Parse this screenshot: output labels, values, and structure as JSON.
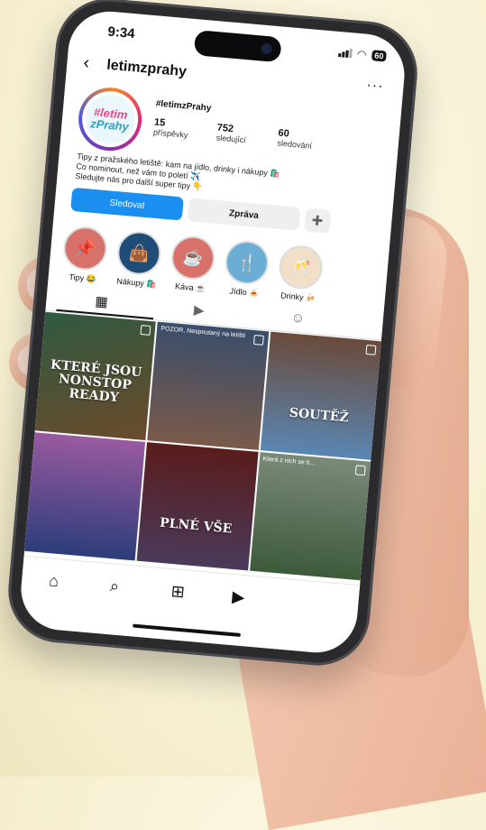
{
  "status_bar": {
    "time": "9:34",
    "battery": "60"
  },
  "header": {
    "back_icon": "chevron-left-icon",
    "username": "letimzprahy",
    "more_label": "···"
  },
  "profile": {
    "avatar_line1": "#letim",
    "avatar_line2": "zPrahy",
    "name": "#letimzPrahy",
    "stats": [
      {
        "value": "15",
        "label": "příspěvky"
      },
      {
        "value": "752",
        "label": "sledující"
      },
      {
        "value": "60",
        "label": "sledování"
      }
    ],
    "bio": [
      "Tipy z pražského letiště: kam na jídlo, drinky i nákupy 🛍️",
      "Co nominout, než vám to poletí ✈️",
      "Sledujte nás pro další super tipy 👇"
    ],
    "follow_label": "Sledovat",
    "message_label": "Zpráva",
    "add_user_icon": "add-person-icon"
  },
  "highlights": [
    {
      "label": "Tipy 😂",
      "icon": "pin-icon",
      "color": "#d9716b"
    },
    {
      "label": "Nákupy 🛍️",
      "icon": "shopping-bag-icon",
      "color": "#1f4d78"
    },
    {
      "label": "Káva ☕",
      "icon": "coffee-icon",
      "color": "#d9716b"
    },
    {
      "label": "Jídlo 🍝",
      "icon": "fork-knife-icon",
      "color": "#6aaed6"
    },
    {
      "label": "Drinky 🍻",
      "icon": "champagne-icon",
      "color": "#f2dfc8"
    }
  ],
  "tabs": [
    {
      "icon": "grid-icon",
      "active": true
    },
    {
      "icon": "reels-icon",
      "active": false
    },
    {
      "icon": "tagged-icon",
      "active": false
    }
  ],
  "posts": [
    {
      "caption": "KTERÉ JSOU NONSTOP READY",
      "overlay": "",
      "bg": "#3b5c4a"
    },
    {
      "caption": "",
      "overlay": "POZOR, Nespoutaný na letišti",
      "bg": "#4d5766"
    },
    {
      "caption": "SOUTĚŽ",
      "overlay": "",
      "bg": "#5a7da3"
    },
    {
      "caption": "",
      "overlay": "",
      "bg": "#8a5a8f"
    },
    {
      "caption": "PLNÉ VŠE",
      "overlay": "",
      "bg": "#7a2c2c"
    },
    {
      "caption": "",
      "overlay": "Která z nich se ti...",
      "bg": "#5d7c5a"
    }
  ],
  "navbar": [
    "home-icon",
    "search-icon",
    "create-icon",
    "reels-icon"
  ]
}
